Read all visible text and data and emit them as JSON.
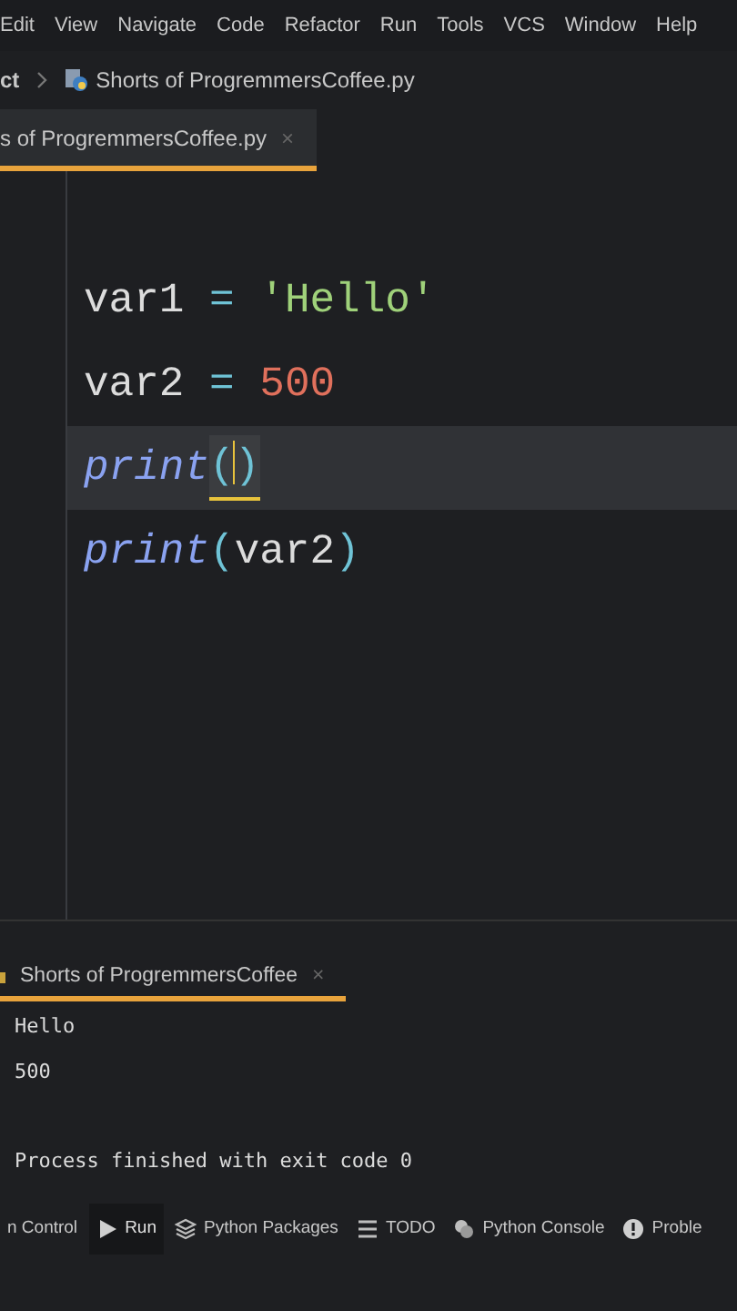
{
  "menu": [
    "Edit",
    "View",
    "Navigate",
    "Code",
    "Refactor",
    "Run",
    "Tools",
    "VCS",
    "Window",
    "Help"
  ],
  "breadcrumb": {
    "project": "ct",
    "file": "Shorts of ProgremmersCoffee.py"
  },
  "editor_tabs": [
    {
      "label": "s of ProgremmersCoffee.py",
      "close": "×",
      "selected": true
    }
  ],
  "code_lines": [
    {
      "current": false,
      "tokens": [
        {
          "kind": "name",
          "text": "var1"
        },
        {
          "kind": "op",
          "text": " = "
        },
        {
          "kind": "string",
          "text": "'Hello'"
        }
      ]
    },
    {
      "current": false,
      "tokens": [
        {
          "kind": "name",
          "text": "var2"
        },
        {
          "kind": "op",
          "text": " = "
        },
        {
          "kind": "number",
          "text": "500"
        }
      ]
    },
    {
      "current": true,
      "tokens": [
        {
          "kind": "builtin",
          "text": "print"
        },
        {
          "kind": "paren",
          "text": "(",
          "matched": true,
          "caret_after": true
        },
        {
          "kind": "paren",
          "text": ")",
          "matched": true,
          "caret_after": false
        }
      ]
    },
    {
      "current": false,
      "tokens": [
        {
          "kind": "builtin",
          "text": "print"
        },
        {
          "kind": "paren",
          "text": "(",
          "matched": false,
          "caret_after": false
        },
        {
          "kind": "name",
          "text": "var2"
        },
        {
          "kind": "paren",
          "text": ")",
          "matched": false,
          "caret_after": false
        }
      ]
    }
  ],
  "run_tabs": [
    {
      "label": "Shorts of ProgremmersCoffee",
      "close": "×",
      "selected": true
    }
  ],
  "output": [
    "Hello",
    "500",
    "Process finished with exit code 0"
  ],
  "tool_windows": [
    {
      "label": "n Control",
      "kind": "plain",
      "selected": false
    },
    {
      "label": "Run",
      "kind": "play",
      "selected": true
    },
    {
      "label": "Python Packages",
      "kind": "layers",
      "selected": false
    },
    {
      "label": "TODO",
      "kind": "list",
      "selected": false
    },
    {
      "label": "Python Console",
      "kind": "python",
      "selected": false
    },
    {
      "label": "Proble",
      "kind": "alert",
      "selected": false
    }
  ]
}
